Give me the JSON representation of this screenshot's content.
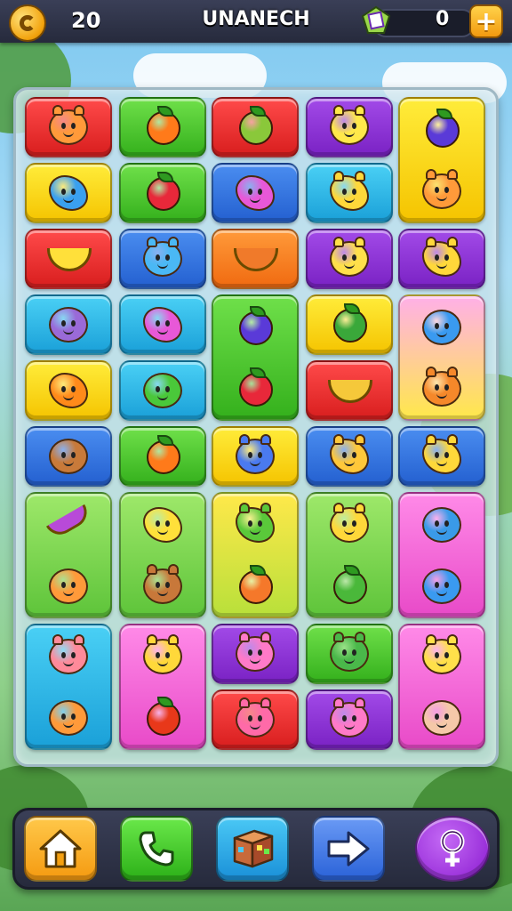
{
  "header": {
    "score": "20",
    "title": "UNANECH",
    "gem_count": "0",
    "plus_label": "+"
  },
  "board": {
    "columns": 5,
    "tiles": [
      {
        "name": "tile-orange-creature",
        "color": "red",
        "items": [
          "orange-creature-icon"
        ]
      },
      {
        "name": "tile-orange-fruit",
        "color": "green",
        "items": [
          "orange-fruit-icon"
        ]
      },
      {
        "name": "tile-green-pear",
        "color": "red",
        "items": [
          "pear-icon"
        ]
      },
      {
        "name": "tile-yellow-creature",
        "color": "purple",
        "items": [
          "yellow-creature-icon"
        ]
      },
      {
        "name": "tile-plum-and-creature",
        "color": "yellow",
        "items": [
          "plum-icon",
          "orange-creature-icon"
        ]
      },
      {
        "name": "tile-blue-star",
        "color": "yellow",
        "items": [
          "blue-star-icon"
        ]
      },
      {
        "name": "tile-red-berry",
        "color": "green",
        "items": [
          "red-berry-icon"
        ]
      },
      {
        "name": "tile-pink-flower",
        "color": "blue",
        "items": [
          "pink-flower-icon"
        ]
      },
      {
        "name": "tile-yellow-star",
        "color": "cyan",
        "items": [
          "yellow-star-creature-icon"
        ]
      },
      {
        "name": "tile-banana",
        "color": "red",
        "items": [
          "banana-icon"
        ]
      },
      {
        "name": "tile-blue-creature",
        "color": "blue",
        "items": [
          "blue-creature-icon"
        ]
      },
      {
        "name": "tile-orange-boat",
        "color": "orange",
        "items": [
          "orange-bowl-icon"
        ]
      },
      {
        "name": "tile-yellow-bear",
        "color": "purple",
        "items": [
          "yellow-bear-icon"
        ]
      },
      {
        "name": "tile-yellow-star-2",
        "color": "purple",
        "items": [
          "yellow-star-creature-icon"
        ]
      },
      {
        "name": "tile-purple-fish",
        "color": "cyan",
        "items": [
          "purple-fish-icon"
        ]
      },
      {
        "name": "tile-pink-flower-2",
        "color": "cyan",
        "items": [
          "pink-flower-icon"
        ]
      },
      {
        "name": "tile-plum-strawberry",
        "color": "green",
        "items": [
          "plum-icon",
          "strawberry-icon"
        ]
      },
      {
        "name": "tile-green-seed",
        "color": "yellow",
        "items": [
          "green-seed-icon"
        ]
      },
      {
        "name": "tile-blue-fish-bear",
        "color": "pinkyel",
        "items": [
          "blue-fish-icon",
          "orange-bear-icon"
        ]
      },
      {
        "name": "tile-orange-star",
        "color": "yellow",
        "items": [
          "orange-star-icon"
        ]
      },
      {
        "name": "tile-green-fish",
        "color": "cyan",
        "items": [
          "green-fish-icon"
        ]
      },
      {
        "name": "tile-yellow-leaf",
        "color": "red",
        "items": [
          "yellow-leaf-icon"
        ]
      },
      {
        "name": "tile-house",
        "color": "blue",
        "items": [
          "house-block-icon"
        ]
      },
      {
        "name": "tile-orange-2",
        "color": "green",
        "items": [
          "orange-fruit-icon"
        ]
      },
      {
        "name": "tile-blue-splat",
        "color": "yellow",
        "items": [
          "blue-splat-creature-icon"
        ]
      },
      {
        "name": "tile-sunflower",
        "color": "blue",
        "items": [
          "sunflower-creature-icon"
        ]
      },
      {
        "name": "tile-yellow-star-3",
        "color": "blue",
        "items": [
          "yellow-star-creature-icon"
        ]
      },
      {
        "name": "tile-carrot-fish",
        "color": "ltgreen",
        "items": [
          "purple-carrot-icon",
          "orange-fish-icon"
        ]
      },
      {
        "name": "tile-star-box",
        "color": "ltgreen",
        "items": [
          "yellow-star-icon",
          "box-creature-icon"
        ]
      },
      {
        "name": "tile-sun-seed",
        "color": "yelgrad",
        "items": [
          "green-sun-creature-icon",
          "orange-seed-icon"
        ]
      },
      {
        "name": "tile-pyramid-bean",
        "color": "ltgreen",
        "items": [
          "pyramid-creature-icon",
          "green-bean-icon"
        ]
      },
      {
        "name": "tile-ufo-fish",
        "color": "pink",
        "items": [
          "ufo-icon",
          "blue-fish-icon"
        ]
      },
      {
        "name": "tile-pig-fish",
        "color": "cyan",
        "items": [
          "pink-pig-icon",
          "orange-fish-icon"
        ]
      },
      {
        "name": "tile-bird-apple",
        "color": "pink",
        "items": [
          "yellow-bird-icon",
          "red-apple-icon"
        ]
      },
      {
        "name": "tile-pink-creature",
        "color": "purple",
        "items": [
          "pink-creature-icon"
        ]
      },
      {
        "name": "tile-green-creature",
        "color": "green",
        "items": [
          "green-creature-icon"
        ]
      },
      {
        "name": "tile-bear-cup",
        "color": "pink",
        "items": [
          "yellow-bear-icon",
          "cup-icon"
        ]
      },
      {
        "name": "tile-pink-bear",
        "color": "red",
        "items": [
          "pink-bear-icon"
        ]
      },
      {
        "name": "tile-pink-creature-2",
        "color": "purple",
        "items": [
          "pink-creature-icon"
        ]
      }
    ]
  },
  "bottom_nav": [
    {
      "name": "home-button",
      "icon": "home-icon",
      "color": "#f5a010"
    },
    {
      "name": "phone-button",
      "icon": "phone-icon",
      "color": "#3ac420"
    },
    {
      "name": "box-button",
      "icon": "box-icon",
      "color": "#2aa0e8"
    },
    {
      "name": "next-button",
      "icon": "arrow-right-icon",
      "color": "#3a7ae8"
    },
    {
      "name": "profile-button",
      "icon": "female-symbol-icon",
      "color": "#9a2ad8"
    }
  ]
}
